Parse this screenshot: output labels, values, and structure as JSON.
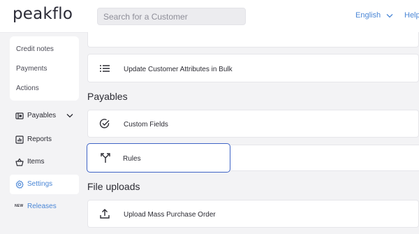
{
  "header": {
    "logo": "peakflo",
    "search_placeholder": "Search for a Customer",
    "language": "English",
    "help": "Help"
  },
  "sidebar": {
    "sub_items": [
      "Credit notes",
      "Payments",
      "Actions"
    ],
    "items": [
      {
        "label": "Payables",
        "icon": "payables-icon"
      },
      {
        "label": "Reports",
        "icon": "reports-icon"
      },
      {
        "label": "Items",
        "icon": "basket-icon"
      },
      {
        "label": "Settings",
        "icon": "gear-icon",
        "active": true
      },
      {
        "label": "Releases",
        "icon": "new-badge",
        "badge": "NEW"
      }
    ]
  },
  "main": {
    "receivables_rows": [
      {
        "label": "Update Customer Attributes in Bulk",
        "icon": "list-icon"
      }
    ],
    "payables_title": "Payables",
    "payables_rows": [
      {
        "label": "Custom Fields",
        "icon": "check-circle-icon"
      },
      {
        "label": "Rules",
        "icon": "split-arrow-icon",
        "selected": true
      }
    ],
    "file_uploads_title": "File uploads",
    "file_uploads_rows": [
      {
        "label": "Upload Mass Purchase Order",
        "icon": "upload-icon"
      }
    ]
  },
  "colors": {
    "accent": "#4a86d6",
    "selected_border": "#3e63c6",
    "background": "#f3f3f5"
  }
}
